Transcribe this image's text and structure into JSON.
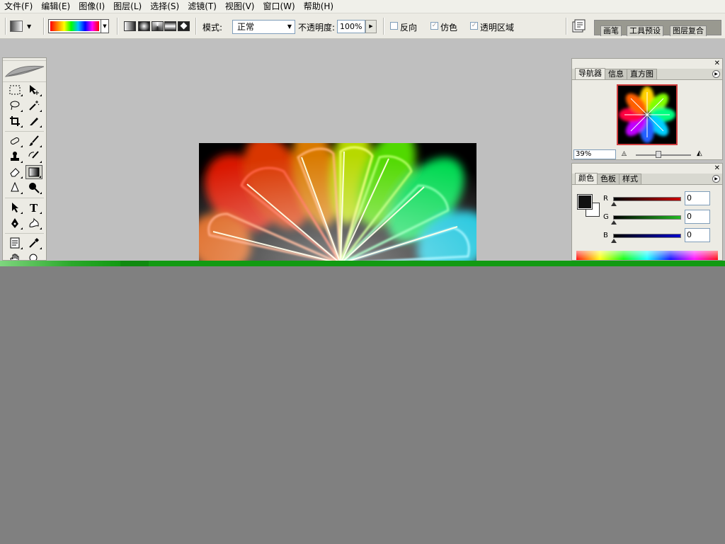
{
  "menu": [
    "文件(F)",
    "编辑(E)",
    "图像(I)",
    "图层(L)",
    "选择(S)",
    "滤镜(T)",
    "视图(V)",
    "窗口(W)",
    "帮助(H)"
  ],
  "options": {
    "mode_label": "模式:",
    "mode_value": "正常",
    "opacity_label": "不透明度:",
    "opacity_value": "100%",
    "reverse_label": "反向",
    "dither_label": "仿色",
    "transparency_label": "透明区域",
    "dither_checked": "✓",
    "transparency_checked": "✓"
  },
  "palette_well": [
    "画笔",
    "工具预设",
    "图层复合"
  ],
  "navigator": {
    "tabs": [
      "导航器",
      "信息",
      "直方图"
    ],
    "zoom": "39%"
  },
  "color_panel": {
    "tabs": [
      "颜色",
      "色板",
      "样式"
    ],
    "channels": [
      {
        "label": "R",
        "value": "0",
        "color": "#cc0000"
      },
      {
        "label": "G",
        "value": "0",
        "color": "#22bb22"
      },
      {
        "label": "B",
        "value": "0",
        "color": "#0000cc"
      }
    ],
    "foreground": "#111111",
    "background": "#ffffff"
  },
  "progress": {
    "fraction": 0.2
  }
}
